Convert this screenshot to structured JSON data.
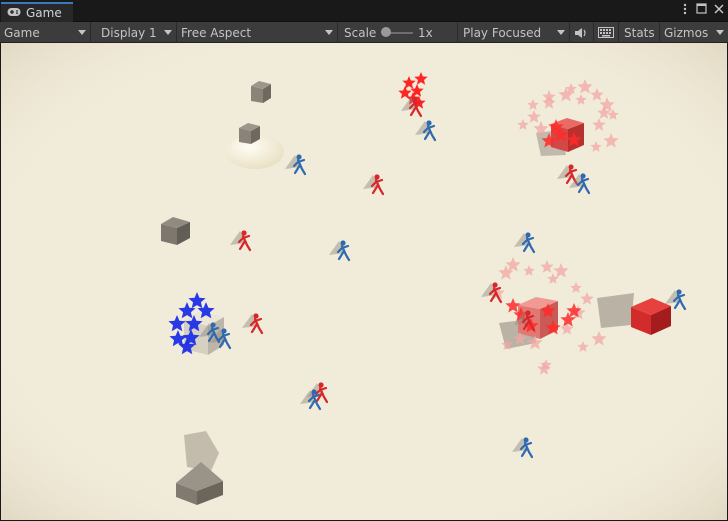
{
  "tab": {
    "label": "Game",
    "icon": "gamepad-icon"
  },
  "tab_controls": {
    "menu_icon": "kebab-menu-icon",
    "maximize_icon": "maximize-icon",
    "close_icon": "close-icon"
  },
  "toolbar": {
    "game_dropdown": "Game",
    "display_dropdown": "Display 1",
    "aspect_dropdown": "Free Aspect",
    "scale_label": "Scale",
    "scale_value": "1x",
    "play_mode_dropdown": "Play Focused",
    "audio_icon": "speaker-icon",
    "keyboard_icon": "keyboard-icon",
    "stats_label": "Stats",
    "gizmos_label": "Gizmos"
  },
  "colors": {
    "ground": "#f1ebda",
    "team_red": "#d8262a",
    "team_blue": "#2f6ab0",
    "blue_star": "#1d2fe6",
    "pale_star": "#f2a7a4",
    "grey_cube": "#837d74"
  },
  "scene": {
    "icons": [
      "grey-cube",
      "red-cube",
      "white-cube",
      "star-burst",
      "red-runner",
      "blue-runner"
    ]
  }
}
